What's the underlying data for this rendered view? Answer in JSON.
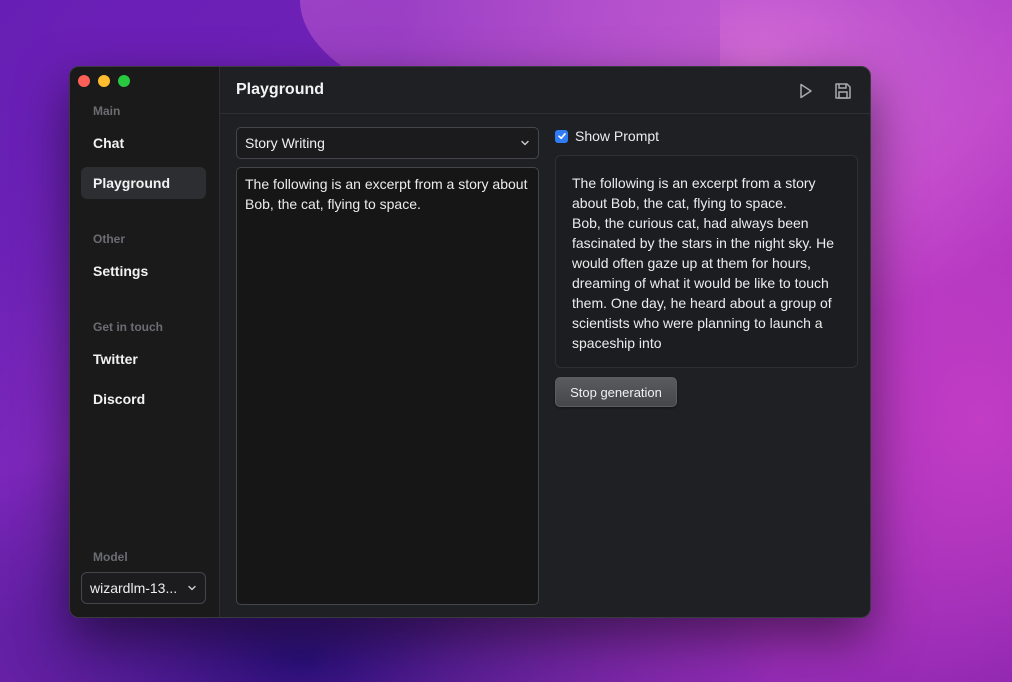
{
  "sidebar": {
    "sections": {
      "main": "Main",
      "other": "Other",
      "get_in_touch": "Get in touch",
      "model": "Model"
    },
    "items": [
      {
        "label": "Chat"
      },
      {
        "label": "Playground",
        "active": true
      },
      {
        "label": "Settings"
      },
      {
        "label": "Twitter"
      },
      {
        "label": "Discord"
      }
    ],
    "model_value": "wizardlm-13..."
  },
  "header": {
    "title": "Playground",
    "icons": [
      "play-icon",
      "save-icon"
    ]
  },
  "playground": {
    "preset_value": "Story Writing",
    "prompt_text": "The following is an excerpt from a story about Bob, the cat, flying to space.",
    "show_prompt_label": "Show Prompt",
    "show_prompt_checked": true,
    "output_text": "The following is an excerpt from a story about Bob, the cat, flying to space.\nBob, the curious cat, had always been fascinated by the stars in the night sky. He would often gaze up at them for hours, dreaming of what it would be like to touch them. One day, he heard about a group of scientists who were planning to launch a spaceship into",
    "stop_button_label": "Stop generation"
  },
  "colors": {
    "accent": "#2f7cf6",
    "window_bg": "#1f2023",
    "sidebar_bg": "#1a1a1b"
  }
}
